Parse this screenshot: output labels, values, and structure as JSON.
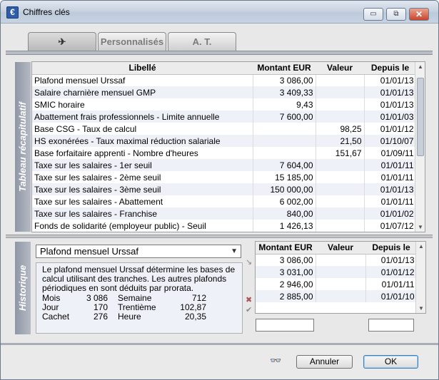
{
  "window": {
    "title": "Chiffres clés",
    "minimize": "▭",
    "restore": "⧉",
    "close": "✕",
    "app_icon": "€"
  },
  "tabs": [
    {
      "label": "✈",
      "icon": "plane-icon",
      "active": true
    },
    {
      "label": "Personnalisés",
      "active": false
    },
    {
      "label": "A. T.",
      "active": false
    }
  ],
  "summary": {
    "side_label": "Tableau récapitulatif",
    "columns": [
      "Libellé",
      "Montant EUR",
      "Valeur",
      "Depuis le"
    ],
    "rows": [
      [
        "Plafond mensuel Urssaf",
        "3 086,00",
        "",
        "01/01/13"
      ],
      [
        "Salaire charnière mensuel GMP",
        "3 409,33",
        "",
        "01/01/13"
      ],
      [
        "SMIC horaire",
        "9,43",
        "",
        "01/01/13"
      ],
      [
        "Abattement frais professionnels - Limite annuelle",
        "7 600,00",
        "",
        "01/01/03"
      ],
      [
        "Base CSG - Taux de calcul",
        "",
        "98,25",
        "01/01/12"
      ],
      [
        "HS exonérées - Taux maximal réduction salariale",
        "",
        "21,50",
        "01/10/07"
      ],
      [
        "Base forfaitaire apprenti - Nombre d'heures",
        "",
        "151,67",
        "01/09/11"
      ],
      [
        "Taxe sur les salaires - 1er seuil",
        "7 604,00",
        "",
        "01/01/11"
      ],
      [
        "Taxe sur les salaires - 2ème seuil",
        "15 185,00",
        "",
        "01/01/11"
      ],
      [
        "Taxe sur les salaires - 3ème seuil",
        "150 000,00",
        "",
        "01/01/13"
      ],
      [
        "Taxe sur les salaires - Abattement",
        "6 002,00",
        "",
        "01/01/11"
      ],
      [
        "Taxe sur les salaires - Franchise",
        "840,00",
        "",
        "01/01/02"
      ],
      [
        "Fonds de solidarité (employeur public) - Seuil",
        "1 426,13",
        "",
        "01/07/12"
      ]
    ]
  },
  "history": {
    "side_label": "Historique",
    "selected": "Plafond mensuel Urssaf",
    "description": "Le plafond mensuel Urssaf détermine les bases de calcul utilisant des tranches. Les autres plafonds périodiques en sont déduits par prorata.",
    "periods": [
      [
        "Mois",
        "3 086",
        "Semaine",
        "712"
      ],
      [
        "Jour",
        "170",
        "Trentième",
        "102,87"
      ],
      [
        "Cachet",
        "276",
        "Heure",
        "20,35"
      ]
    ],
    "columns": [
      "Montant EUR",
      "Valeur",
      "Depuis le"
    ],
    "rows": [
      [
        "3 086,00",
        "",
        "01/01/13"
      ],
      [
        "3 031,00",
        "",
        "01/01/12"
      ],
      [
        "2 946,00",
        "",
        "01/01/11"
      ],
      [
        "2 885,00",
        "",
        "01/01/10"
      ]
    ]
  },
  "footer": {
    "cancel": "Annuler",
    "ok": "OK",
    "glasses_icon": "glasses-icon"
  }
}
